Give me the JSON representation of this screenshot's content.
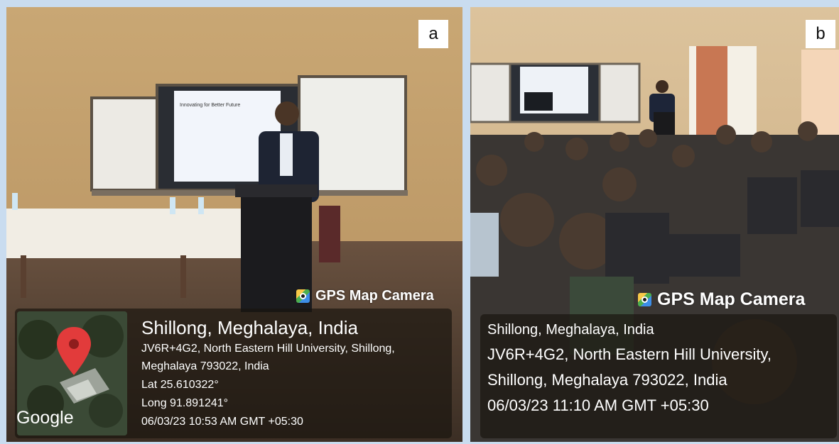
{
  "panel_a": {
    "label": "a",
    "gps_title": "GPS Map Camera",
    "map_brand": "Google",
    "location_title": "Shillong, Meghalaya, India",
    "address_line1": "JV6R+4G2, North Eastern Hill University, Shillong,",
    "address_line2": "Meghalaya 793022, India",
    "lat": "Lat 25.610322°",
    "long": "Long 91.891241°",
    "timestamp": "06/03/23 10:53 AM GMT +05:30",
    "slide_title": "Innovating for Better Future"
  },
  "panel_b": {
    "label": "b",
    "gps_title": "GPS Map Camera",
    "location_title": "Shillong, Meghalaya, India",
    "address_line1": "JV6R+4G2, North Eastern Hill University,",
    "address_line2": "Shillong, Meghalaya 793022, India",
    "timestamp": "06/03/23 11:10 AM GMT +05:30"
  },
  "colors": {
    "frame": "#c9dcef",
    "wall": "#d6b88a",
    "overlay": "#19140f",
    "pin": "#e23b3b"
  },
  "icons": [
    "gps-camera-icon",
    "map-pin-icon"
  ]
}
